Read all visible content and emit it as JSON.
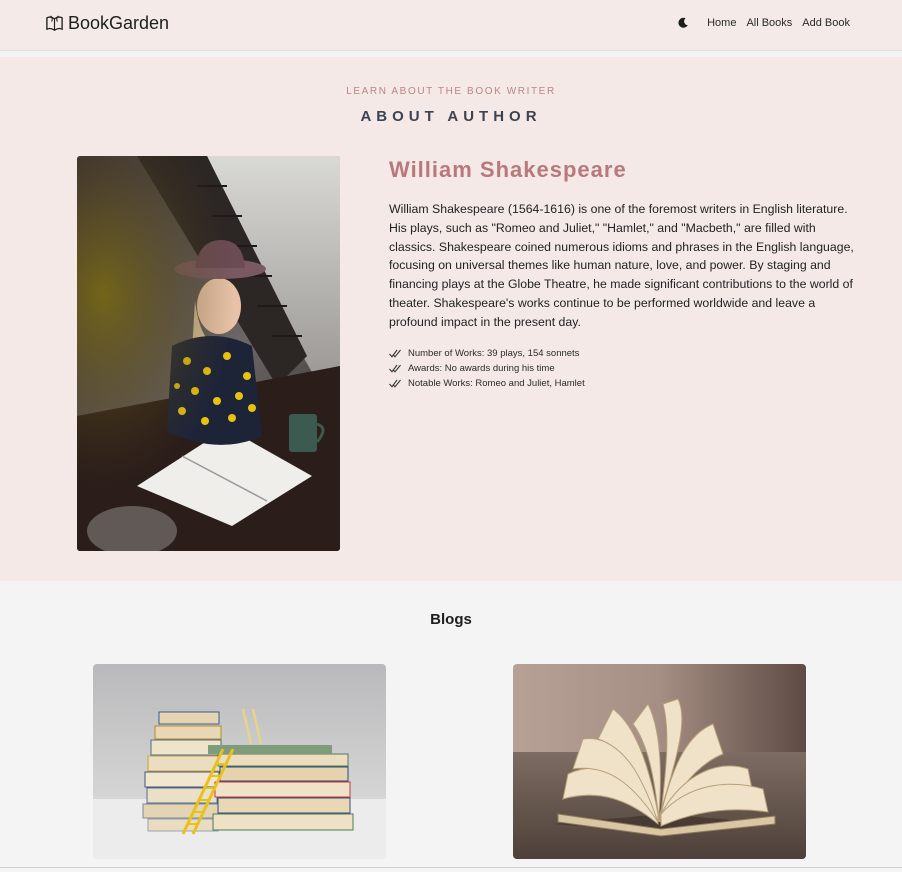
{
  "brand": {
    "name": "BookGarden",
    "icon": "book-logo-icon"
  },
  "nav": {
    "theme_icon": "moon-icon",
    "links": [
      {
        "label": "Home"
      },
      {
        "label": "All Books"
      },
      {
        "label": "Add Book"
      }
    ]
  },
  "about": {
    "kicker": "LEARN ABOUT THE BOOK WRITER",
    "title": "ABOUT AUTHOR",
    "author_name": "William Shakespeare",
    "bio": "William Shakespeare (1564-1616) is one of the foremost writers in English literature. His plays, such as \"Romeo and Juliet,\" \"Hamlet,\" and \"Macbeth,\" are filled with classics. Shakespeare coined numerous idioms and phrases in the English language, focusing on universal themes like human nature, love, and power. By staging and financing plays at the Globe Theatre, he made significant contributions to the world of theater. Shakespeare's works continue to be performed worldwide and leave a profound impact in the present day.",
    "facts": [
      {
        "text": "Number of Works: 39 plays, 154 sonnets"
      },
      {
        "text": "Awards: No awards during his time"
      },
      {
        "text": "Notable Works: Romeo and Juliet, Hamlet"
      }
    ]
  },
  "blogs": {
    "title": "Blogs"
  },
  "colors": {
    "nav_bg": "#f4ebe8",
    "about_bg": "#f4e9e7",
    "accent": "#b7797c",
    "kicker": "#b98685",
    "page_bg": "#f4f4f4"
  }
}
